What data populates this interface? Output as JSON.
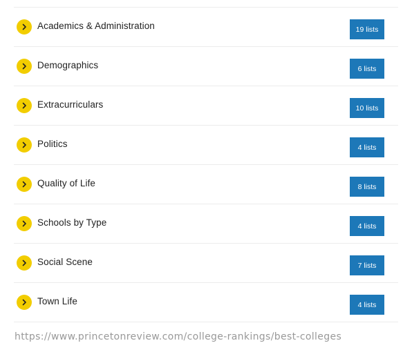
{
  "categories": [
    {
      "label": "Academics & Administration",
      "count": "19 lists"
    },
    {
      "label": "Demographics",
      "count": "6 lists"
    },
    {
      "label": "Extracurriculars",
      "count": "10 lists"
    },
    {
      "label": "Politics",
      "count": "4 lists"
    },
    {
      "label": "Quality of Life",
      "count": "8 lists"
    },
    {
      "label": "Schools by Type",
      "count": "4 lists"
    },
    {
      "label": "Social Scene",
      "count": "7 lists"
    },
    {
      "label": "Town Life",
      "count": "4 lists"
    }
  ],
  "icons": {
    "row_icon": "chevron-right-icon"
  },
  "colors": {
    "chevron_bg": "#f2cd00",
    "badge_bg": "#1d78b8",
    "divider": "#ececec",
    "watermark": "#999999"
  },
  "watermark": "https://www.princetonreview.com/college-rankings/best-colleges"
}
